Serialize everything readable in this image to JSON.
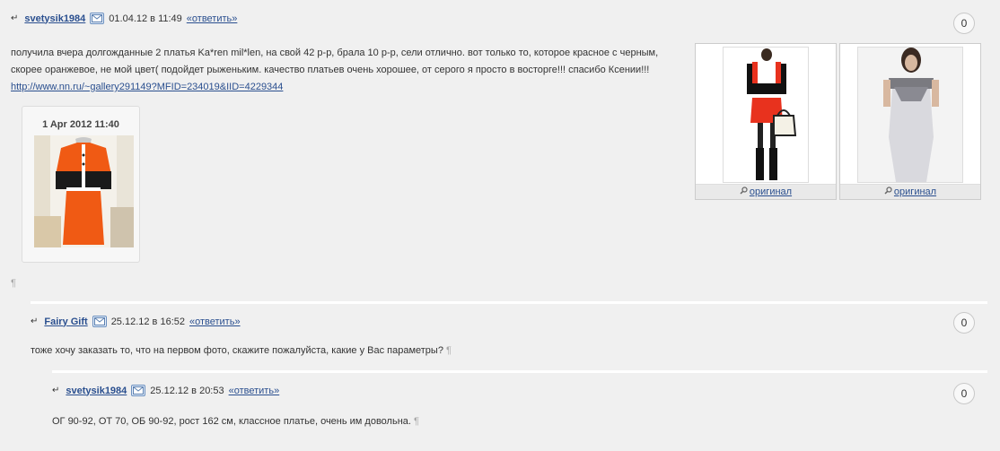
{
  "comments": [
    {
      "author": "svetysik1984",
      "date": "01.04.12 в 11:49",
      "reply_label": "«ответить»",
      "count": "0",
      "text": "получила вчера долгожданные 2 платья Ka*ren mil*len, на свой 42 р-р, брала 10 р-р, сели отлично. вот только то, которое красное с черным, скорее оранжевое, не мой цвет( подойдет рыженьким. качество платьев очень хорошее, от серого я просто в восторге!!! спасибо Ксении!!!",
      "link": "http://www.nn.ru/~gallery291149?MFID=234019&IID=4229344",
      "photo_date": "1 Apr 2012 11:40",
      "pilcrow": "¶",
      "thumbs": [
        {
          "label": "оригинал"
        },
        {
          "label": "оригинал"
        }
      ]
    },
    {
      "author": "Fairy Gift",
      "date": "25.12.12 в 16:52",
      "reply_label": "«ответить»",
      "count": "0",
      "text": "тоже хочу заказать то, что на первом фото, скажите пожалуйста, какие у Вас параметры?",
      "pilcrow": "¶"
    },
    {
      "author": "svetysik1984",
      "date": "25.12.12 в 20:53",
      "reply_label": "«ответить»",
      "count": "0",
      "text": "ОГ 90-92, ОТ 70, ОБ 90-92, рост 162 см, классное платье, очень им довольна.",
      "pilcrow": "¶"
    }
  ],
  "icons": {
    "reply_arrow": "reply-arrow-icon",
    "mail": "mail-icon",
    "zoom": "magnifier-icon"
  },
  "colors": {
    "link": "#2a4f8f",
    "background": "#f0f0f0"
  }
}
